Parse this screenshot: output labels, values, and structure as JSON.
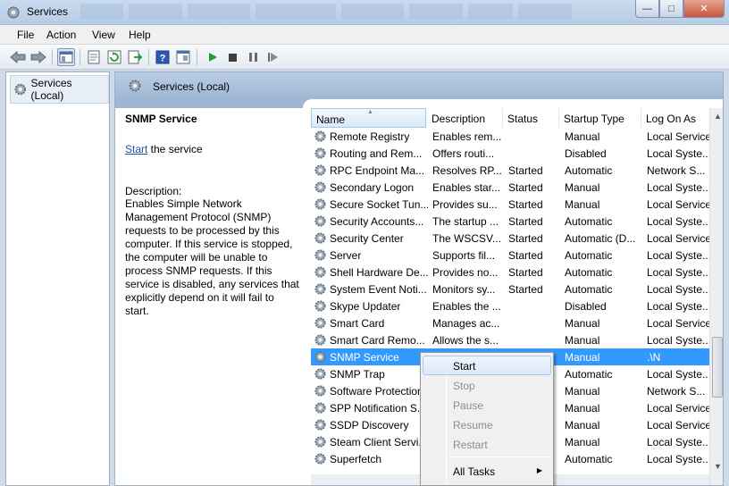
{
  "window": {
    "title": "Services"
  },
  "menu": [
    "File",
    "Action",
    "View",
    "Help"
  ],
  "tree": {
    "root_label": "Services (Local)"
  },
  "pane": {
    "header_label": "Services (Local)"
  },
  "detail": {
    "service_title": "SNMP Service",
    "start_link": "Start",
    "start_suffix": " the service",
    "description_label": "Description:",
    "description_text": "Enables Simple Network Management Protocol (SNMP) requests to be processed by this computer. If this service is stopped, the computer will be unable to process SNMP requests. If this service is disabled, any services that explicitly depend on it will fail to start."
  },
  "columns": [
    "Name",
    "Description",
    "Status",
    "Startup Type",
    "Log On As"
  ],
  "rows": [
    {
      "name": "Remote Registry",
      "desc": "Enables rem...",
      "status": "",
      "startup": "Manual",
      "logon": "Local Service"
    },
    {
      "name": "Routing and Rem...",
      "desc": "Offers routi...",
      "status": "",
      "startup": "Disabled",
      "logon": "Local Syste..."
    },
    {
      "name": "RPC Endpoint Ma...",
      "desc": "Resolves RP...",
      "status": "Started",
      "startup": "Automatic",
      "logon": "Network S..."
    },
    {
      "name": "Secondary Logon",
      "desc": "Enables star...",
      "status": "Started",
      "startup": "Manual",
      "logon": "Local Syste..."
    },
    {
      "name": "Secure Socket Tun...",
      "desc": "Provides su...",
      "status": "Started",
      "startup": "Manual",
      "logon": "Local Service"
    },
    {
      "name": "Security Accounts...",
      "desc": "The startup ...",
      "status": "Started",
      "startup": "Automatic",
      "logon": "Local Syste..."
    },
    {
      "name": "Security Center",
      "desc": "The WSCSV...",
      "status": "Started",
      "startup": "Automatic (D...",
      "logon": "Local Service"
    },
    {
      "name": "Server",
      "desc": "Supports fil...",
      "status": "Started",
      "startup": "Automatic",
      "logon": "Local Syste..."
    },
    {
      "name": "Shell Hardware De...",
      "desc": "Provides no...",
      "status": "Started",
      "startup": "Automatic",
      "logon": "Local Syste..."
    },
    {
      "name": "System Event Noti...",
      "desc": "Monitors sy...",
      "status": "Started",
      "startup": "Automatic",
      "logon": "Local Syste..."
    },
    {
      "name": "Skype Updater",
      "desc": "Enables the ...",
      "status": "",
      "startup": "Disabled",
      "logon": "Local Syste..."
    },
    {
      "name": "Smart Card",
      "desc": "Manages ac...",
      "status": "",
      "startup": "Manual",
      "logon": "Local Service"
    },
    {
      "name": "Smart Card Remo...",
      "desc": "Allows the s...",
      "status": "",
      "startup": "Manual",
      "logon": "Local Syste..."
    },
    {
      "name": "SNMP Service",
      "desc": "",
      "status": "",
      "startup": "Manual",
      "logon": ".\\N"
    },
    {
      "name": "SNMP Trap",
      "desc": "",
      "status": "",
      "startup": "Automatic",
      "logon": "Local Syste..."
    },
    {
      "name": "Software Protection",
      "desc": "",
      "status": "",
      "startup": "Manual",
      "logon": "Network S..."
    },
    {
      "name": "SPP Notification S...",
      "desc": "",
      "status": "",
      "startup": "Manual",
      "logon": "Local Service"
    },
    {
      "name": "SSDP Discovery",
      "desc": "",
      "status": "",
      "startup": "Manual",
      "logon": "Local Service"
    },
    {
      "name": "Steam Client Servi...",
      "desc": "",
      "status": "",
      "startup": "Manual",
      "logon": "Local Syste..."
    },
    {
      "name": "Superfetch",
      "desc": "",
      "status": "",
      "startup": "Automatic",
      "logon": "Local Syste..."
    }
  ],
  "selected_row": 13,
  "context_menu": {
    "items": [
      "Start",
      "Stop",
      "Pause",
      "Resume",
      "Restart",
      "All Tasks"
    ]
  },
  "colors": {
    "selection": "#3399ff",
    "link": "#1e50a2",
    "header_band": "#9fb7d3"
  },
  "icons": [
    "services-app-icon",
    "back-arrow-icon",
    "forward-arrow-icon",
    "console-tree-icon",
    "properties-icon",
    "refresh-icon",
    "export-icon",
    "help-icon",
    "snapin-icon",
    "play-icon",
    "stop-icon",
    "pause-icon",
    "restart-icon",
    "gear-icon"
  ]
}
